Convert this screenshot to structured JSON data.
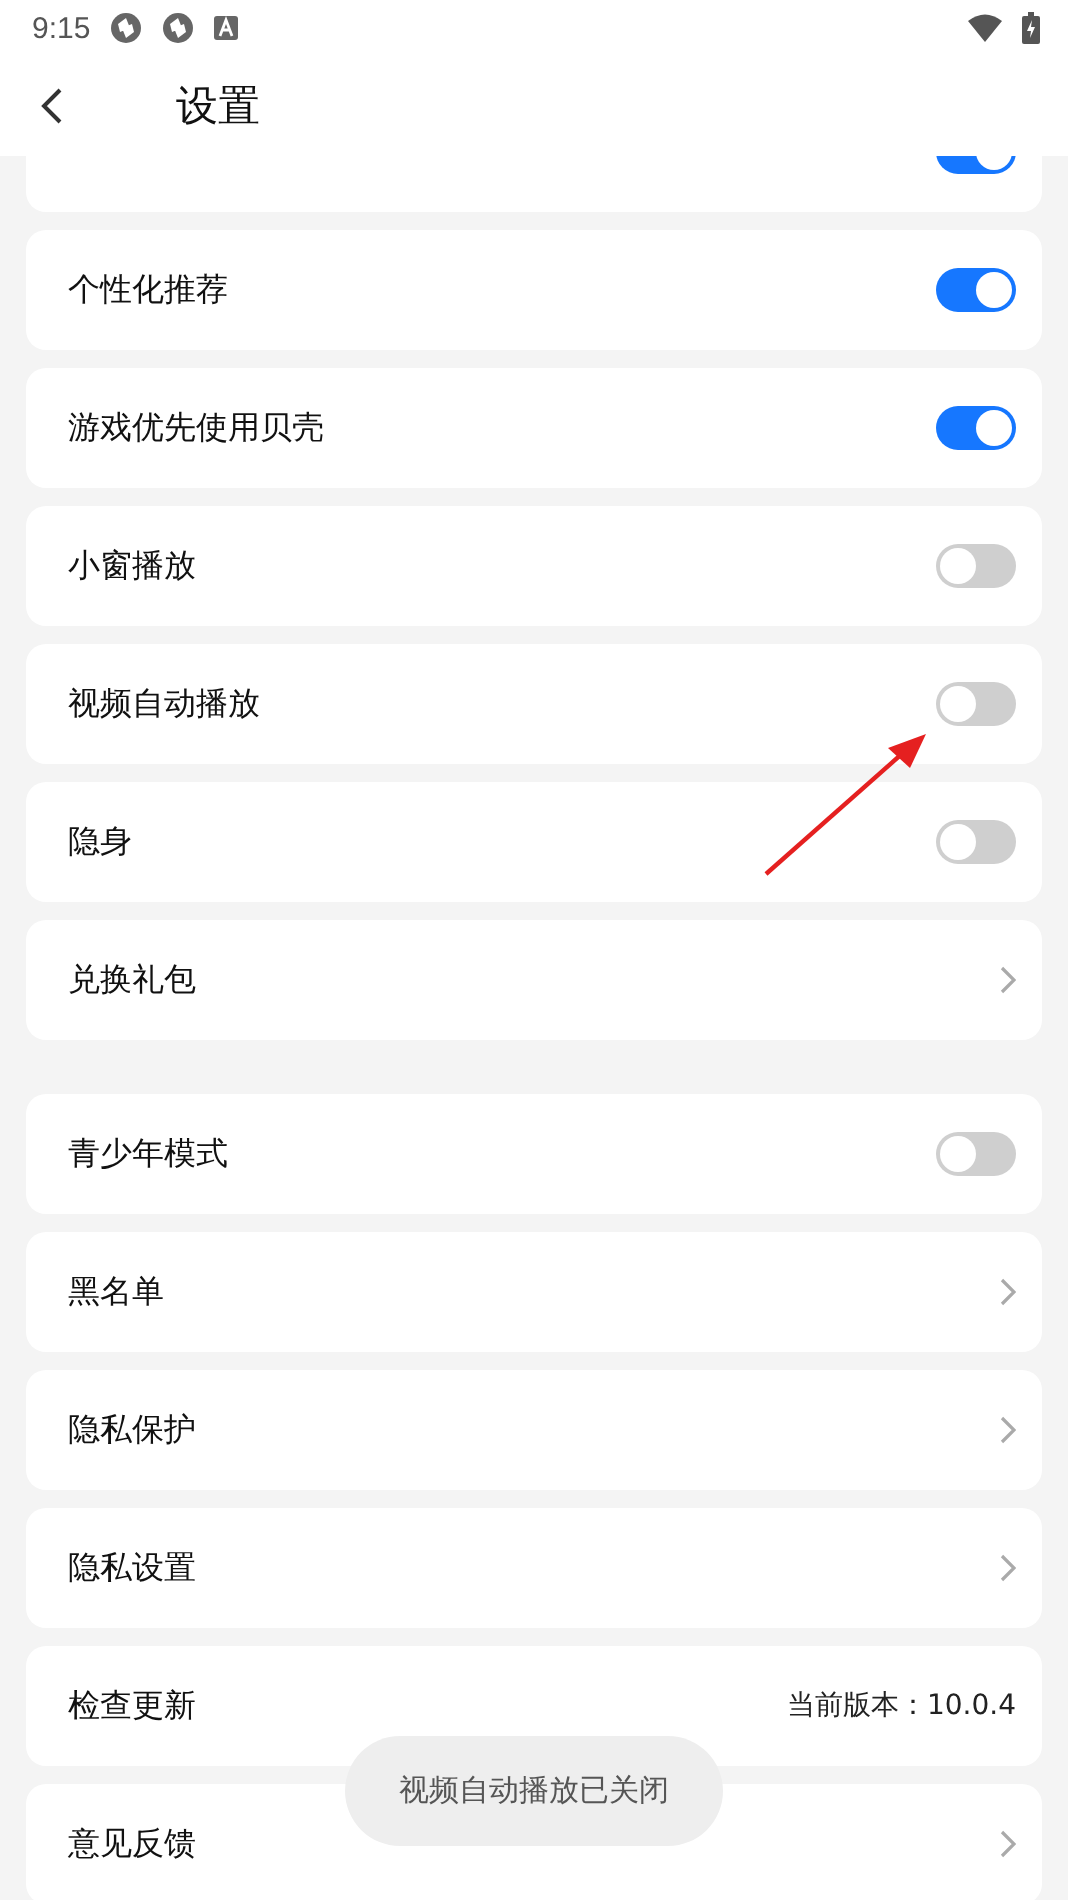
{
  "status_bar": {
    "time": "9:15"
  },
  "header": {
    "title": "设置"
  },
  "groups": [
    {
      "items": [
        {
          "kind": "switch",
          "on": true
        },
        {
          "kind": "switch",
          "label": "个性化推荐",
          "on": true
        },
        {
          "kind": "switch",
          "label": "游戏优先使用贝壳",
          "on": true
        },
        {
          "kind": "switch",
          "label": "小窗播放",
          "on": false
        },
        {
          "kind": "switch",
          "label": "视频自动播放",
          "on": false
        },
        {
          "kind": "switch",
          "label": "隐身",
          "on": false
        },
        {
          "kind": "link",
          "label": "兑换礼包"
        }
      ]
    },
    {
      "items": [
        {
          "kind": "switch",
          "label": "青少年模式",
          "on": false
        },
        {
          "kind": "link",
          "label": "黑名单"
        },
        {
          "kind": "link",
          "label": "隐私保护"
        },
        {
          "kind": "link",
          "label": "隐私设置"
        },
        {
          "kind": "value",
          "label": "检查更新",
          "value": "当前版本：10.0.4"
        },
        {
          "kind": "link",
          "label": "意见反馈"
        }
      ]
    }
  ],
  "toast": "视频自动播放已关闭"
}
